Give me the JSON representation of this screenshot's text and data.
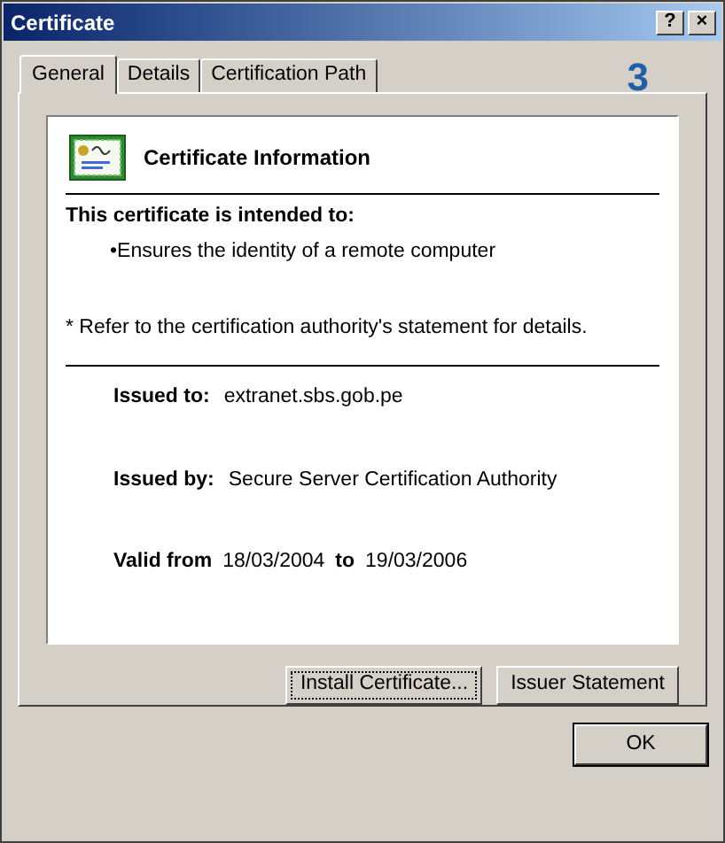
{
  "window": {
    "title": "Certificate",
    "title_buttons": [
      "?",
      "×"
    ]
  },
  "tabs": [
    {
      "label": "General",
      "selected": true
    },
    {
      "label": "Details",
      "selected": false
    },
    {
      "label": "Certification Path",
      "selected": false
    }
  ],
  "annotation": "3",
  "info": {
    "heading": "Certificate Information",
    "purpose_title": "This certificate is intended to:",
    "purposes": [
      "Ensures the identity of a remote computer"
    ],
    "bullet": "•",
    "note": "* Refer to the certification authority's statement for details.",
    "issued_to_label": "Issued to:",
    "issued_to": "extranet.sbs.gob.pe",
    "issued_by_label": "Issued by:",
    "issued_by": "Secure Server Certification Authority",
    "valid_from_label": "Valid from",
    "valid_from": "18/03/2004",
    "valid_to_label": "to",
    "valid_to": "19/03/2006"
  },
  "buttons": [
    {
      "label": "Install Certificate...",
      "focused": true
    },
    {
      "label": "Issuer Statement",
      "focused": false
    }
  ],
  "ok_button": "OK"
}
